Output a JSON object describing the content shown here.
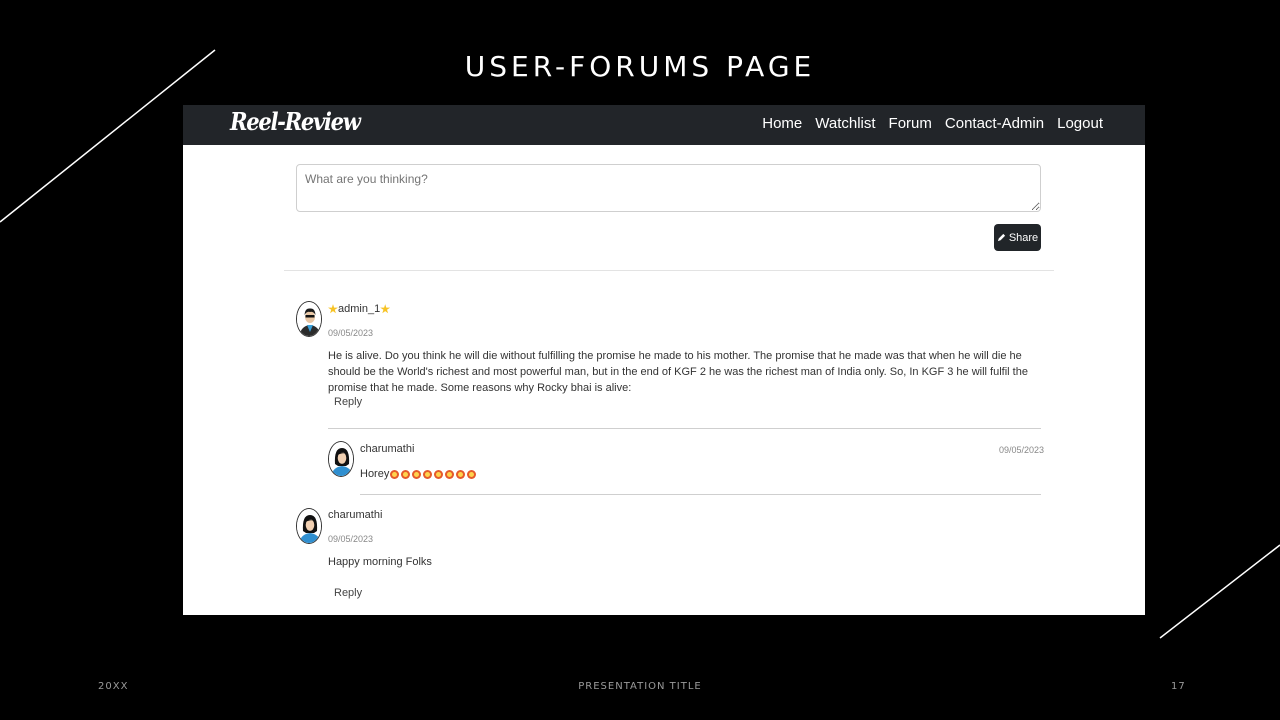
{
  "slide": {
    "title": "USER-FORUMS PAGE",
    "footer_left": "20XX",
    "footer_center": "PRESENTATION TITLE",
    "page_number": "17"
  },
  "navbar": {
    "brand": "Reel-Review",
    "links": [
      "Home",
      "Watchlist",
      "Forum",
      "Contact-Admin",
      "Logout"
    ]
  },
  "composer": {
    "placeholder": "What are you thinking?",
    "share_label": "Share"
  },
  "posts": [
    {
      "username": "admin_1",
      "date": "09/05/2023",
      "body": "He is alive. Do you think he will die without fulfilling the promise he made to his mother. The promise that he made was that when he will die he should be the World's richest and most powerful man, but in the end of KGF 2 he was the richest man of India only. So, In KGF 3 he will fulfil the promise that he made. Some reasons why Rocky bhai is alive:",
      "reply_label": "Reply",
      "replies": [
        {
          "username": "charumathi",
          "date": "09/05/2023",
          "body": "Horey"
        }
      ]
    },
    {
      "username": "charumathi",
      "date": "09/05/2023",
      "body": "Happy morning Folks",
      "reply_label": "Reply"
    }
  ]
}
